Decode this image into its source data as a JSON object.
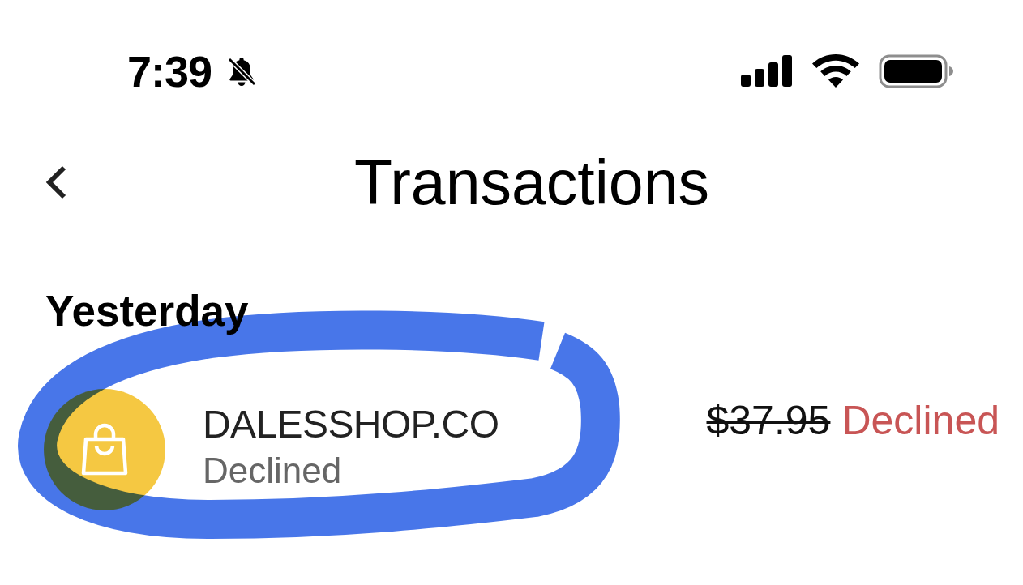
{
  "status_bar": {
    "time": "7:39",
    "silent": true
  },
  "header": {
    "title": "Transactions"
  },
  "sections": [
    {
      "heading": "Yesterday",
      "transactions": [
        {
          "merchant": "DALESSHOP.CO",
          "status": "Declined",
          "amount": "$37.95",
          "struck": true,
          "outcome": "Declined"
        }
      ]
    }
  ]
}
